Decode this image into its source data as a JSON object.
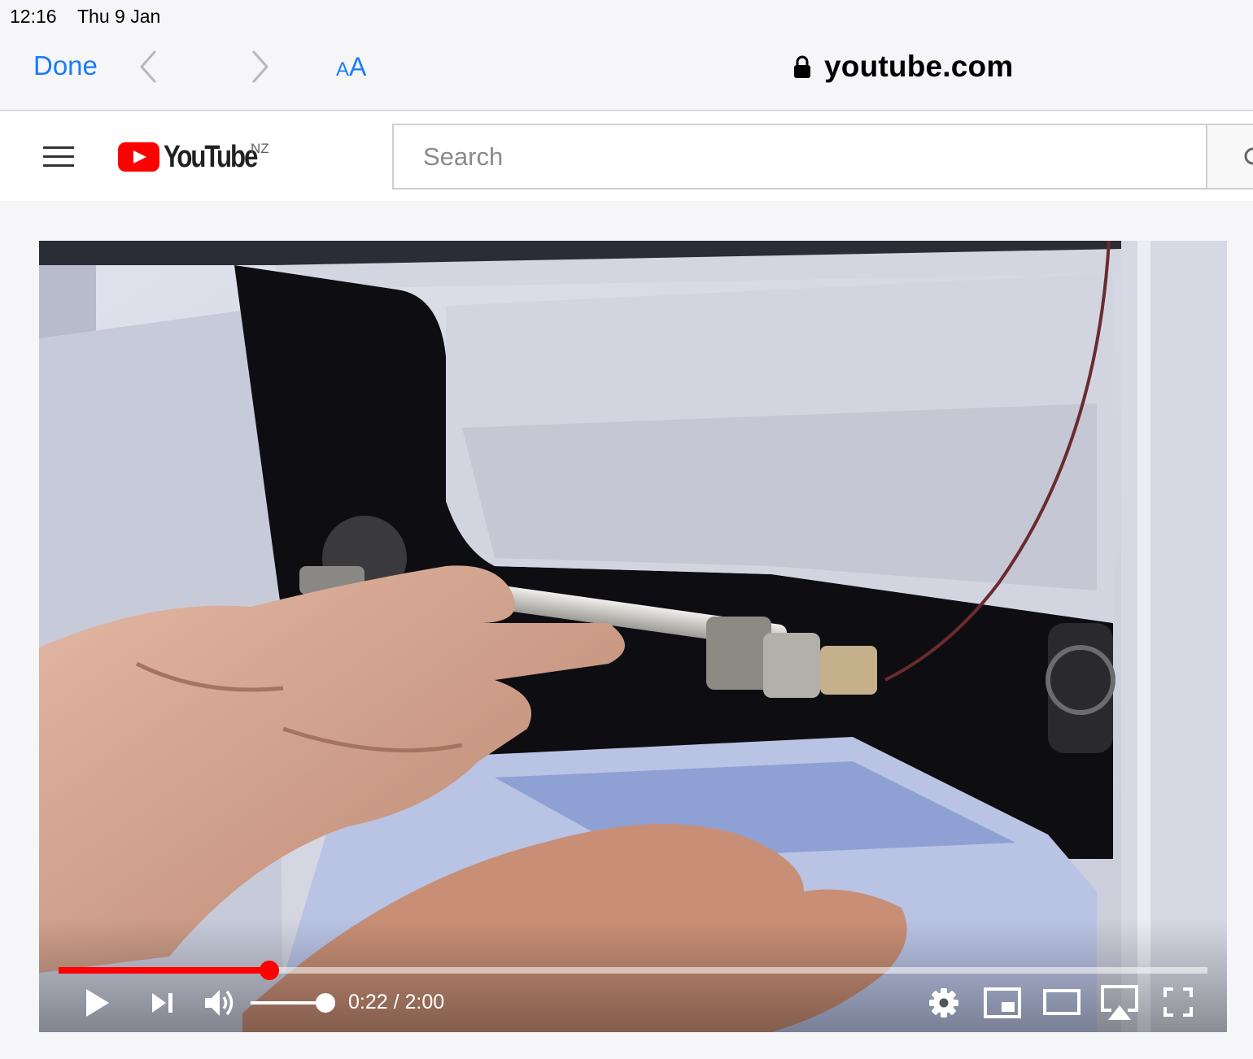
{
  "status_bar": {
    "time": "12:16",
    "date": "Thu 9 Jan"
  },
  "safari_bar": {
    "done_label": "Done",
    "text_size_small": "A",
    "text_size_big": "A",
    "url": "youtube.com",
    "accent_color": "#1a7cf6"
  },
  "youtube": {
    "logo_text": "YouTube",
    "region": "NZ",
    "search_placeholder": "Search",
    "brand_color": "#ff0000"
  },
  "player": {
    "current_time": "0:22",
    "separator": " / ",
    "duration": "2:00",
    "progress_fraction": 0.1833,
    "volume_fraction": 1.0,
    "icons": [
      "play-icon",
      "next-icon",
      "volume-icon",
      "gear-icon",
      "miniplayer-icon",
      "theater-icon",
      "airplay-icon",
      "fullscreen-icon"
    ]
  }
}
